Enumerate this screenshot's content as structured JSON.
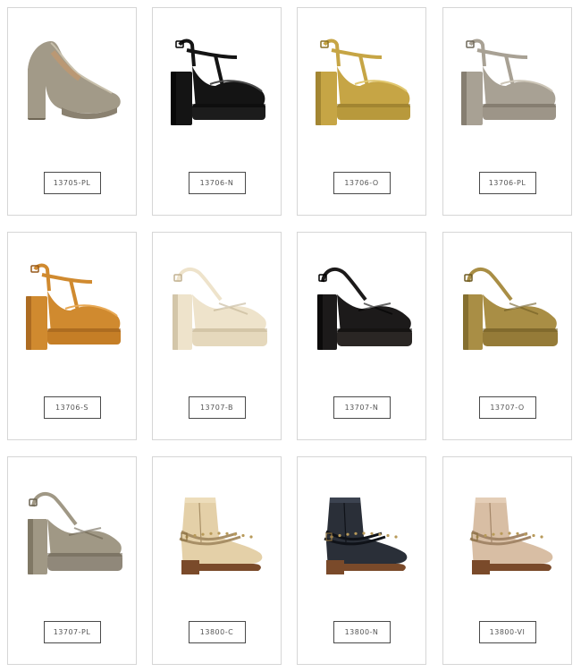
{
  "products": [
    {
      "code": "13705-PL",
      "style": "pump",
      "colors": {
        "main": "#a29a88",
        "dark": "#6e6554",
        "light": "#c9c1ad",
        "sole": "#8a8170"
      },
      "icon": "pump-shoe-icon"
    },
    {
      "code": "13706-N",
      "style": "tstrap",
      "colors": {
        "main": "#141414",
        "dark": "#000000",
        "light": "#4a4a4a",
        "sole": "#1c1c1c"
      },
      "icon": "t-strap-platform-icon"
    },
    {
      "code": "13706-O",
      "style": "tstrap",
      "colors": {
        "main": "#c6a545",
        "dark": "#8c7126",
        "light": "#e1c870",
        "sole": "#b8993c"
      },
      "icon": "t-strap-platform-icon"
    },
    {
      "code": "13706-PL",
      "style": "tstrap",
      "colors": {
        "main": "#a8a194",
        "dark": "#6f685a",
        "light": "#cdc6b8",
        "sole": "#9d9588"
      },
      "icon": "t-strap-platform-icon"
    },
    {
      "code": "13706-S",
      "style": "tstrap",
      "colors": {
        "main": "#d08a2f",
        "dark": "#96591a",
        "light": "#e8a955",
        "sole": "#c57e26"
      },
      "icon": "t-strap-platform-icon"
    },
    {
      "code": "13707-B",
      "style": "slingback",
      "colors": {
        "main": "#eee3cb",
        "dark": "#c2b292",
        "light": "#faf4e6",
        "sole": "#e5d8bc"
      },
      "icon": "slingback-platform-icon"
    },
    {
      "code": "13707-N",
      "style": "slingback",
      "colors": {
        "main": "#1c1a1a",
        "dark": "#000000",
        "light": "#4b4545",
        "sole": "#2a2624"
      },
      "icon": "slingback-platform-icon"
    },
    {
      "code": "13707-O",
      "style": "slingback",
      "colors": {
        "main": "#a98e45",
        "dark": "#6e5a22",
        "light": "#c9b06a",
        "sole": "#957b38"
      },
      "icon": "slingback-platform-icon"
    },
    {
      "code": "13707-PL",
      "style": "slingback",
      "colors": {
        "main": "#a09885",
        "dark": "#6a6250",
        "light": "#c7bfac",
        "sole": "#90887a"
      },
      "icon": "slingback-platform-icon"
    },
    {
      "code": "13800-C",
      "style": "boot",
      "colors": {
        "main": "#e4d0a8",
        "dark": "#a88f66",
        "light": "#f3e6c8",
        "sole": "#7a4a2a"
      },
      "icon": "ankle-boot-icon"
    },
    {
      "code": "13800-N",
      "style": "boot",
      "colors": {
        "main": "#2a2f38",
        "dark": "#0f1218",
        "light": "#4a5160",
        "sole": "#7a4a2a"
      },
      "icon": "ankle-boot-icon"
    },
    {
      "code": "13800-VI",
      "style": "boot",
      "colors": {
        "main": "#d8bea4",
        "dark": "#a38668",
        "light": "#ecd8c4",
        "sole": "#7a4a2a"
      },
      "icon": "ankle-boot-icon"
    }
  ]
}
